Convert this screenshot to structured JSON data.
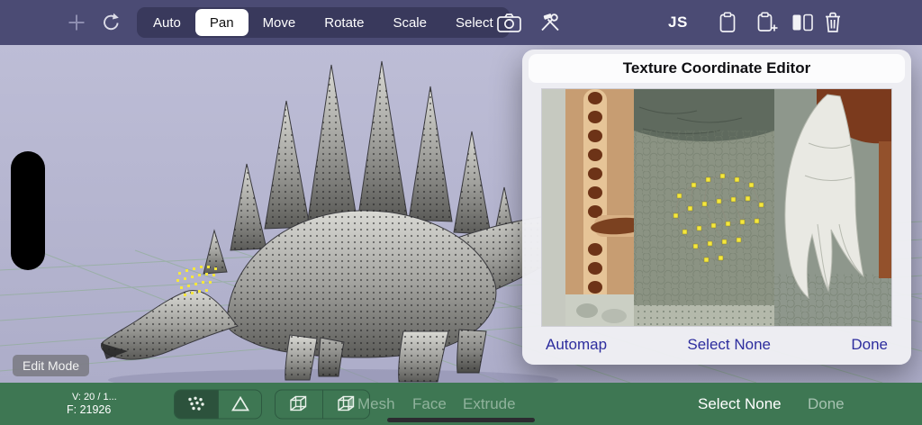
{
  "colors": {
    "topbar_bg": "#4b4b74",
    "seg_bg": "#39395c",
    "viewport_bg": "#b5b5d0",
    "bottombar_bg": "#3e7753",
    "accent_blue": "#2d2d9e",
    "vertex_yellow": "#f5e73d",
    "grid_line": "#84ad84"
  },
  "topbar": {
    "segments": [
      {
        "label": "Auto",
        "selected": false
      },
      {
        "label": "Pan",
        "selected": true
      },
      {
        "label": "Move",
        "selected": false
      },
      {
        "label": "Rotate",
        "selected": false
      },
      {
        "label": "Scale",
        "selected": false
      },
      {
        "label": "Select",
        "selected": false
      }
    ],
    "js_label": "JS"
  },
  "viewport": {
    "edit_mode_label": "Edit Mode"
  },
  "texture_editor": {
    "title": "Texture Coordinate Editor",
    "automap_label": "Automap",
    "select_none_label": "Select None",
    "done_label": "Done"
  },
  "bottombar": {
    "vertex_count": "V: 20 / 1...",
    "face_count": "F: 21926",
    "mesh_label": "Mesh",
    "face_label": "Face",
    "extrude_label": "Extrude",
    "select_none_label": "Select None",
    "done_label": "Done"
  }
}
